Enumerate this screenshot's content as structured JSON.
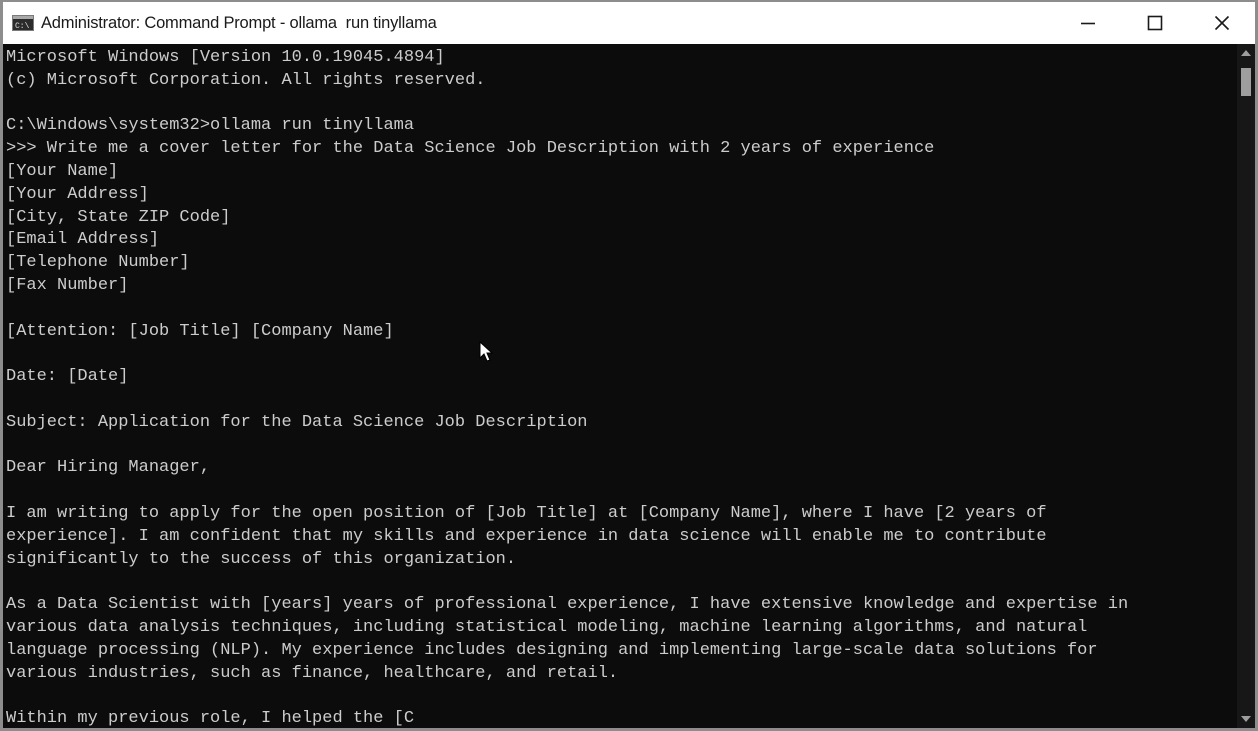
{
  "window": {
    "title": "Administrator: Command Prompt - ollama  run tinyllama"
  },
  "icons": {
    "app": "cmd-icon",
    "minimize": "minimize-icon",
    "maximize": "maximize-icon",
    "close": "close-icon",
    "cursor": "mouse-pointer-icon"
  },
  "colors": {
    "console_background": "#0c0c0c",
    "console_text": "#cccccc",
    "titlebar_background": "#ffffff"
  },
  "console": {
    "lines": [
      "Microsoft Windows [Version 10.0.19045.4894]",
      "(c) Microsoft Corporation. All rights reserved.",
      "",
      "C:\\Windows\\system32>ollama run tinyllama",
      ">>> Write me a cover letter for the Data Science Job Description with 2 years of experience",
      "[Your Name]",
      "[Your Address]",
      "[City, State ZIP Code]",
      "[Email Address]",
      "[Telephone Number]",
      "[Fax Number]",
      "",
      "[Attention: [Job Title] [Company Name]",
      "",
      "Date: [Date]",
      "",
      "Subject: Application for the Data Science Job Description",
      "",
      "Dear Hiring Manager,",
      "",
      "I am writing to apply for the open position of [Job Title] at [Company Name], where I have [2 years of",
      "experience]. I am confident that my skills and experience in data science will enable me to contribute",
      "significantly to the success of this organization.",
      "",
      "As a Data Scientist with [years] years of professional experience, I have extensive knowledge and expertise in",
      "various data analysis techniques, including statistical modeling, machine learning algorithms, and natural",
      "language processing (NLP). My experience includes designing and implementing large-scale data solutions for",
      "various industries, such as finance, healthcare, and retail.",
      "",
      "Within my previous role, I helped the [C"
    ]
  }
}
